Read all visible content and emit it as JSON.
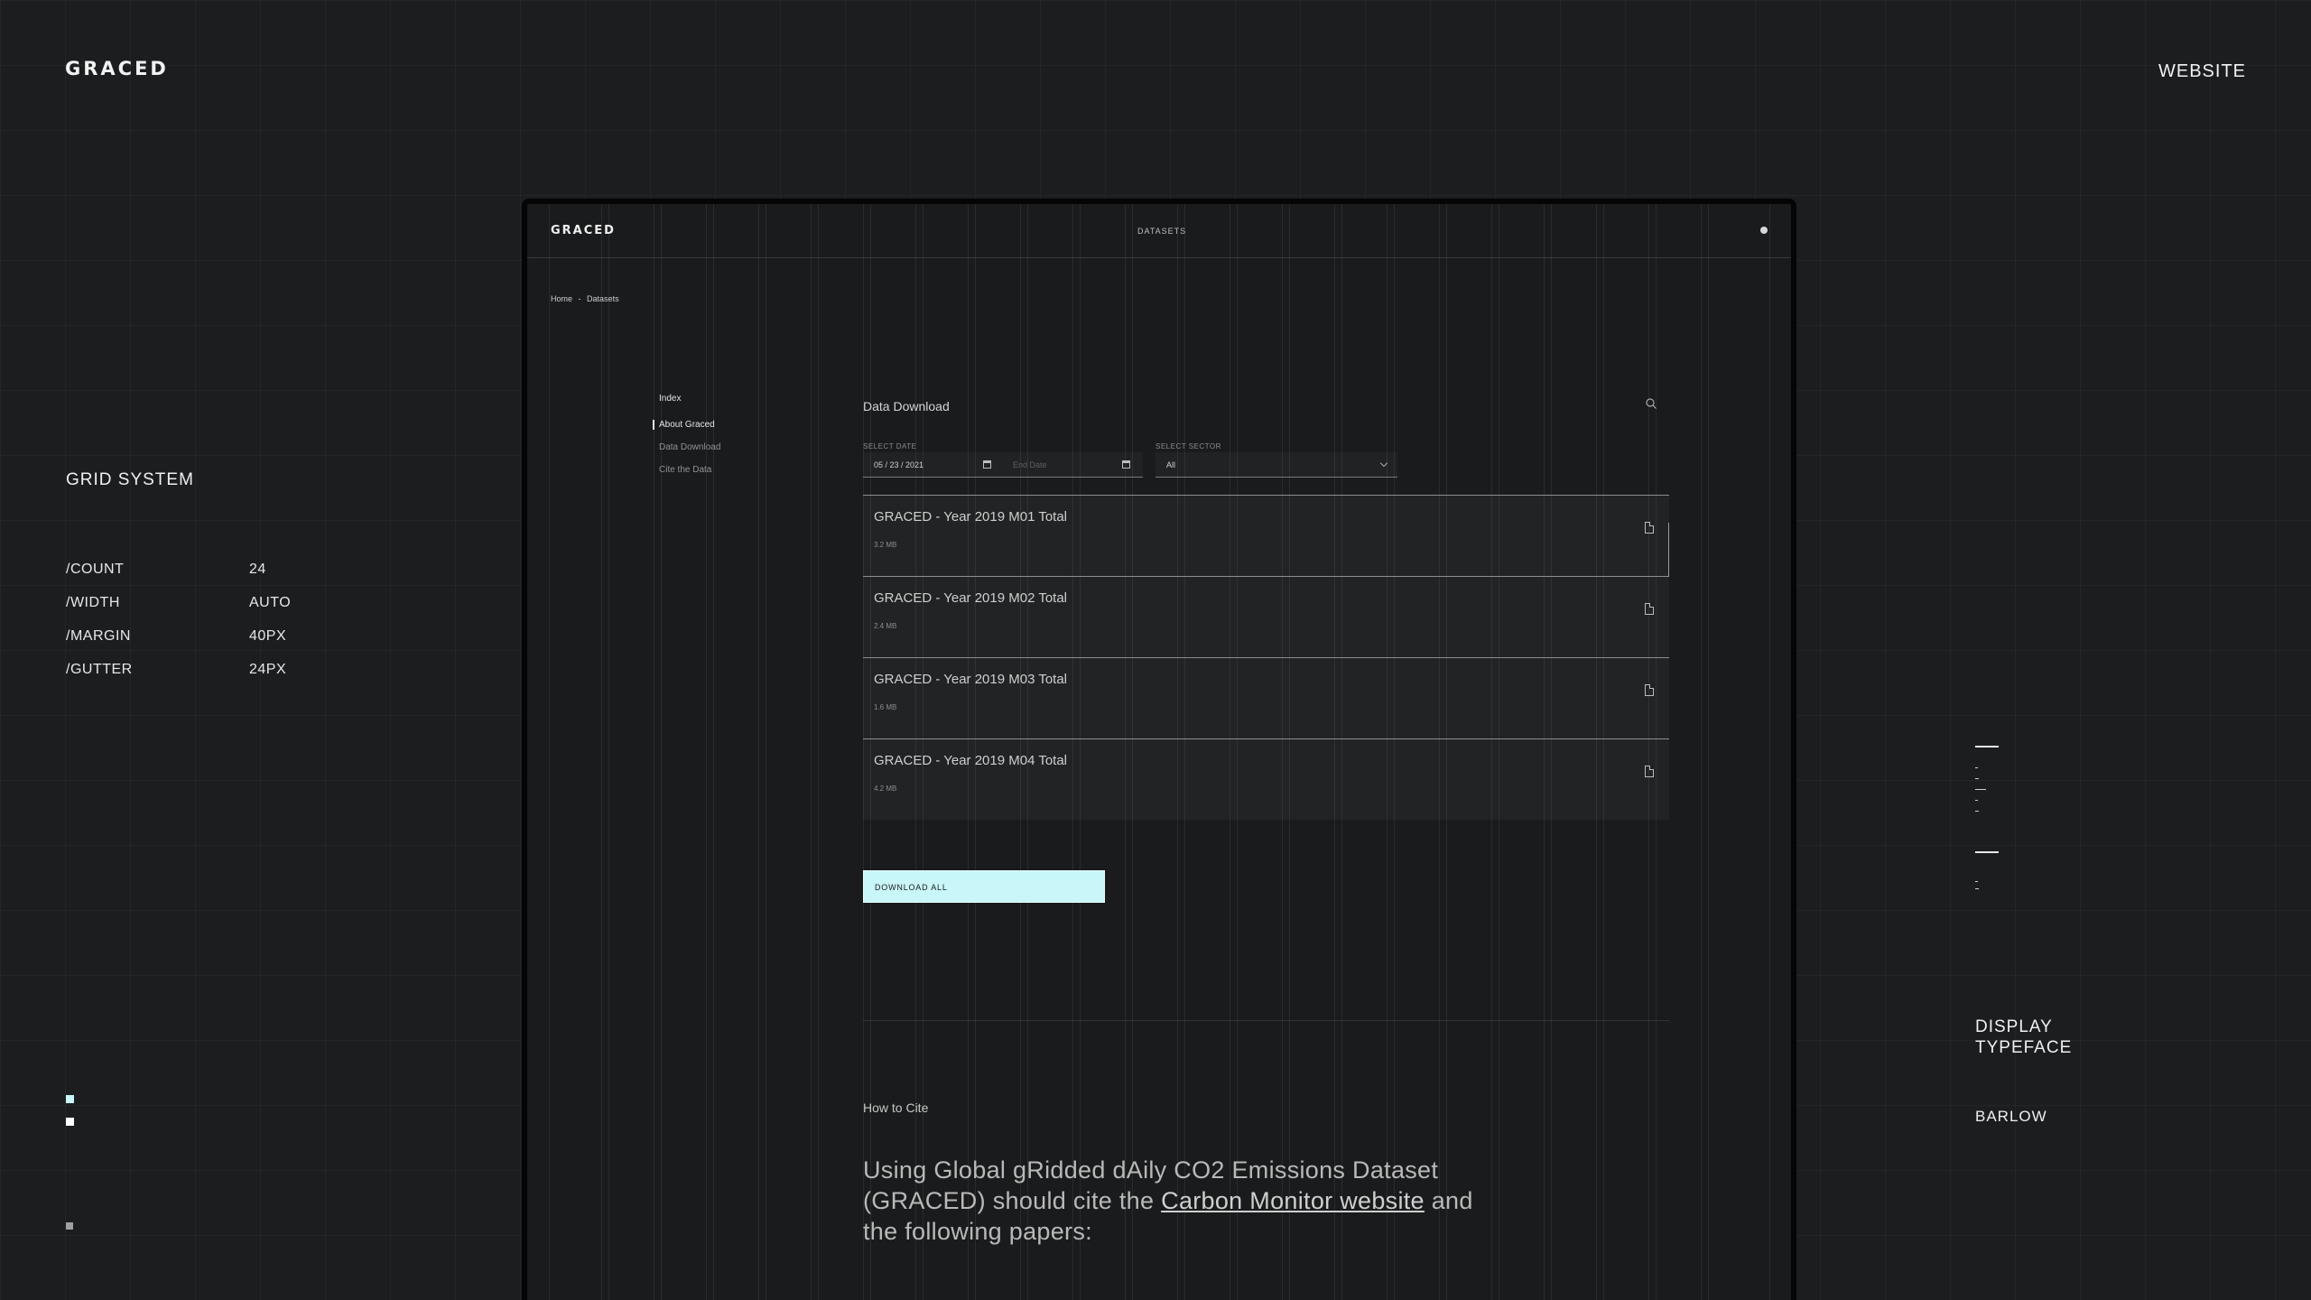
{
  "page": {
    "brand": "GRACED",
    "section_link": "WEBSITE"
  },
  "grid_system": {
    "title": "GRID SYSTEM",
    "specs": [
      {
        "key": "/COUNT",
        "value": "24"
      },
      {
        "key": "/WIDTH",
        "value": "AUTO"
      },
      {
        "key": "/MARGIN",
        "value": "40PX"
      },
      {
        "key": "/GUTTER",
        "value": "24PX"
      }
    ]
  },
  "typeface": {
    "title_line1": "DISPLAY",
    "title_line2": "TYPEFACE",
    "name": "BARLOW"
  },
  "app": {
    "logo": "GRACED",
    "nav_label": "DATASETS",
    "breadcrumb": [
      "Home",
      "-",
      "Datasets"
    ],
    "index": {
      "title": "Index",
      "items": [
        "About Graced",
        "Data Download",
        "Cite the Data"
      ]
    },
    "data_download": {
      "title": "Data Download",
      "select_date_label": "SELECT DATE",
      "start_date": "05 / 23 / 2021",
      "end_date_placeholder": "End Date",
      "select_sector_label": "SELECT SECTOR",
      "sector_value": "All",
      "files": [
        {
          "name": "GRACED - Year 2019 M01 Total",
          "size": "3.2 MB"
        },
        {
          "name": "GRACED - Year 2019 M02 Total",
          "size": "2.4 MB"
        },
        {
          "name": "GRACED - Year 2019 M03 Total",
          "size": "1.6 MB"
        },
        {
          "name": "GRACED - Year 2019 M04 Total",
          "size": "4.2 MB"
        }
      ],
      "download_all": "DOWNLOAD ALL"
    },
    "cite": {
      "label": "How to Cite",
      "text_before": "Using Global gRidded dAily CO2 Emissions Dataset (GRACED) should cite the",
      "link_text": "Carbon Monitor website",
      "text_after": "and the following papers:"
    }
  },
  "colors": {
    "background": "#1b1d1f",
    "accent": "#c8f6f9",
    "text": "#e8e8e8"
  }
}
